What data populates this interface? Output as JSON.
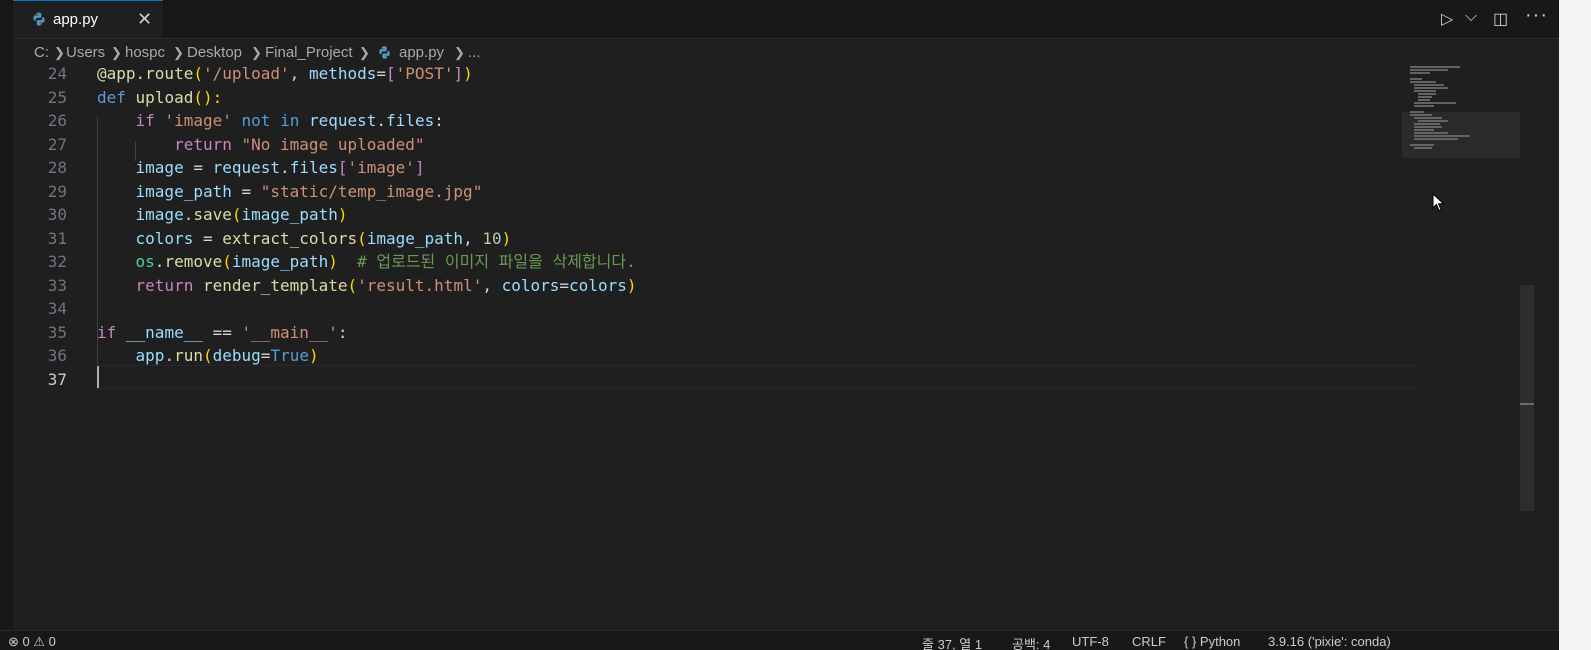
{
  "tab": {
    "label": "app.py",
    "close": "✕"
  },
  "toolbar": {
    "run": "▷",
    "run_dropdown": "⌵",
    "split": "◫",
    "more": "···"
  },
  "breadcrumb": [
    "C:",
    "Users",
    "hospc",
    "Desktop",
    "Final_Project",
    "app.py",
    "..."
  ],
  "lines": [
    {
      "n": "24"
    },
    {
      "n": "25"
    },
    {
      "n": "26"
    },
    {
      "n": "27"
    },
    {
      "n": "28"
    },
    {
      "n": "29"
    },
    {
      "n": "30"
    },
    {
      "n": "31"
    },
    {
      "n": "32"
    },
    {
      "n": "33"
    },
    {
      "n": "34"
    },
    {
      "n": "35"
    },
    {
      "n": "36"
    },
    {
      "n": "37"
    }
  ],
  "code": {
    "l24": [
      "@app.route",
      "(",
      "'/upload'",
      ", ",
      "methods",
      "=",
      "[",
      "'POST'",
      "]",
      ")"
    ],
    "l25": [
      "def",
      " ",
      "upload",
      "():"
    ],
    "l26": [
      "    ",
      "if",
      " ",
      "'image'",
      " ",
      "not",
      " ",
      "in",
      " ",
      "request",
      ".",
      "files",
      ":"
    ],
    "l27": [
      "        ",
      "return",
      " ",
      "\"No image uploaded\""
    ],
    "l28": [
      "    ",
      "image",
      " = ",
      "request",
      ".",
      "files",
      "[",
      "'image'",
      "]"
    ],
    "l29": [
      "    ",
      "image_path",
      " = ",
      "\"static/temp_image.jpg\""
    ],
    "l30": [
      "    ",
      "image",
      ".",
      "save",
      "(",
      "image_path",
      ")"
    ],
    "l31": [
      "    ",
      "colors",
      " = ",
      "extract_colors",
      "(",
      "image_path",
      ", ",
      "10",
      ")"
    ],
    "l32": [
      "    ",
      "os",
      ".",
      "remove",
      "(",
      "image_path",
      ")",
      "  ",
      "# 업로드된 이미지 파일을 삭제합니다."
    ],
    "l33": [
      "    ",
      "return",
      " ",
      "render_template",
      "(",
      "'result.html'",
      ", ",
      "colors",
      "=",
      "colors",
      ")"
    ],
    "l35": [
      "if",
      " ",
      "__name__",
      " == ",
      "'__main__'",
      ":"
    ],
    "l36": [
      "    ",
      "app",
      ".",
      "run",
      "(",
      "debug",
      "=",
      "True",
      ")"
    ]
  },
  "status": {
    "problems": "⊗ 0 ⚠ 0",
    "position": "줄 37, 열 1",
    "spaces": "공백: 4",
    "encoding": "UTF-8",
    "eol": "CRLF",
    "language": "{ } Python",
    "interpreter": "3.9.16 ('pixie': conda)"
  }
}
